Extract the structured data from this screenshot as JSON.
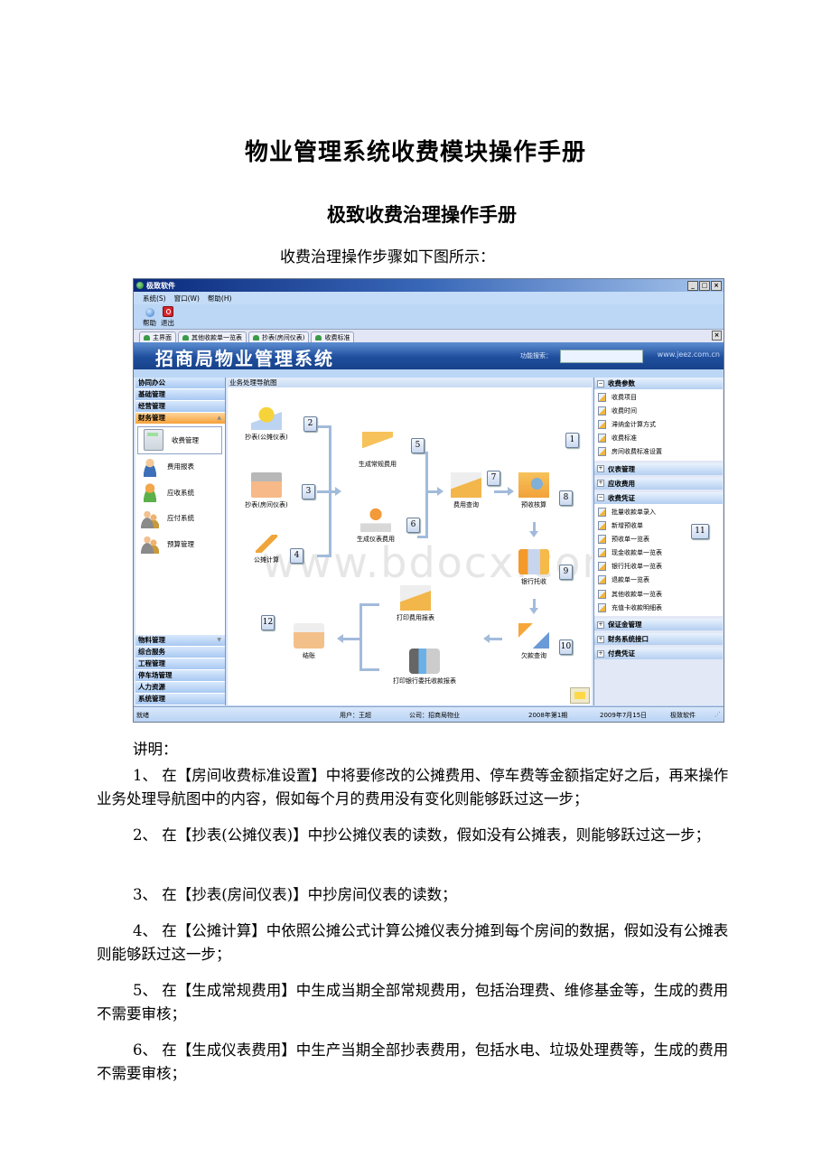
{
  "document": {
    "title": "物业管理系统收费模块操作手册",
    "subtitle": "极致收费治理操作手册",
    "intro": "收费治理操作步骤如下图所示：",
    "explain_label": "讲明：",
    "paragraphs": [
      "1、 在【房间收费标准设置】中将要修改的公摊费用、停车费等金额指定好之后，再来操作业务处理导航图中的内容，假如每个月的费用没有变化则能够跃过这一步；",
      "2、 在【抄表(公摊仪表)】中抄公摊仪表的读数，假如没有公摊表，则能够跃过这一步；",
      "3、 在【抄表(房间仪表)】中抄房间仪表的读数；",
      "4、 在【公摊计算】中依照公摊公式计算公摊仪表分摊到每个房间的数据，假如没有公摊表则能够跃过这一步；",
      "5、 在【生成常规费用】中生成当期全部常规费用，包括治理费、维修基金等，生成的费用不需要审核；",
      "6、 在【生成仪表费用】中生产当期全部抄表费用，包括水电、垃圾处理费等，生成的费用不需要审核；"
    ]
  },
  "app": {
    "window_title": "极致软件",
    "window_controls": [
      "_",
      "□",
      "×"
    ],
    "menu": [
      "系统(S)",
      "窗口(W)",
      "帮助(H)"
    ],
    "toolbar": [
      {
        "label": "帮助",
        "icon": "help-icon"
      },
      {
        "label": "退出",
        "icon": "exit-icon"
      }
    ],
    "tabs": [
      "主界面",
      "其他收款单一览表",
      "抄表(房间仪表)",
      "收费标准"
    ],
    "tab_close": "×",
    "banner_title": "招商局物业管理系统",
    "search_label": "功能搜索：",
    "search_value": "",
    "website": "www.jeez.com.cn",
    "left_nav": {
      "top_groups": [
        "协同办公",
        "基础管理",
        "经营管理",
        "财务管理"
      ],
      "active_group": "财务管理",
      "sub_items": [
        "收费管理",
        "费用报表",
        "应收系统",
        "应付系统",
        "预算管理"
      ],
      "selected_sub": "收费管理",
      "bottom_groups": [
        "物料管理",
        "综合服务",
        "工程管理",
        "停车场管理",
        "人力资源",
        "系统管理"
      ]
    },
    "center": {
      "header": "业务处理导航图",
      "watermark": "www.bdocx.com",
      "nodes": [
        {
          "step": "2",
          "label": "抄表(公摊仪表)"
        },
        {
          "step": "3",
          "label": "抄表(房间仪表)"
        },
        {
          "step": "4",
          "label": "公摊计算"
        },
        {
          "step": "5",
          "label": "生成常规费用"
        },
        {
          "step": "6",
          "label": "生成仪表费用"
        },
        {
          "step": "7",
          "label": "费用查询"
        },
        {
          "step": "8",
          "label": "预收核算"
        },
        {
          "step": "9",
          "label": "银行托收"
        },
        {
          "step": "10",
          "label": "欠款查询"
        },
        {
          "step": "",
          "label": "打印费用报表"
        },
        {
          "step": "",
          "label": "打印银行委托收款报表"
        },
        {
          "step": "12",
          "label": "结账"
        }
      ],
      "callout_1": "1",
      "callout_11": "11"
    },
    "right_panel": {
      "groups": [
        {
          "title": "收费参数",
          "expanded": true,
          "items": [
            "收费项目",
            "收费时间",
            "滞纳金计算方式",
            "收费标准",
            "房间收费标准设置"
          ]
        },
        {
          "title": "仪表管理",
          "expanded": false,
          "items": []
        },
        {
          "title": "应收费用",
          "expanded": false,
          "items": []
        },
        {
          "title": "收费凭证",
          "expanded": true,
          "items": [
            "批量收款单录入",
            "新增预收单",
            "预收单一览表",
            "现金收款单一览表",
            "银行托收单一览表",
            "退款单一览表",
            "其他收款单一览表",
            "充值卡收款明细表"
          ]
        },
        {
          "title": "保证金管理",
          "expanded": false,
          "items": []
        },
        {
          "title": "财务系统接口",
          "expanded": false,
          "items": []
        },
        {
          "title": "付费凭证",
          "expanded": false,
          "items": []
        }
      ]
    },
    "status_bar": {
      "status": "就绪",
      "user": "用户：王超",
      "company": "公司：招商局物业",
      "period": "2008年第1期",
      "date": "2009年7月15日",
      "vendor": "极致软件"
    }
  }
}
